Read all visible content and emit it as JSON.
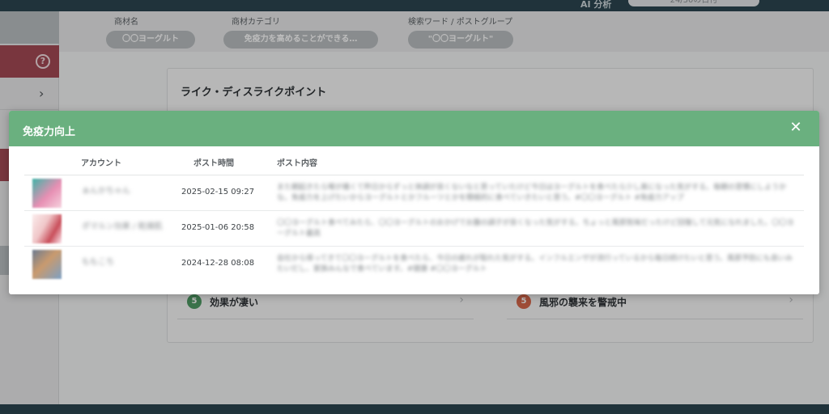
{
  "topbar": {
    "ai_label": "AI 分析",
    "pill_text": "24/30の日付"
  },
  "filters": [
    {
      "label": "商材名",
      "value": "〇〇ヨーグルト"
    },
    {
      "label": "商材カテゴリ",
      "value": "免疫力を高めることができる…"
    },
    {
      "label": "検索ワード / ポストグループ",
      "value": "\"〇〇ヨーグルト\""
    }
  ],
  "panel": {
    "title": "ライク・ディスライクポイント",
    "items": [
      {
        "num": "5",
        "text": "効果が凄い",
        "color": "#4f9a64"
      },
      {
        "num": "5",
        "text": "風邪の襲来を警戒中",
        "color": "#d6674b"
      }
    ]
  },
  "modal": {
    "title": "免疫力向上",
    "close_icon": "close-icon",
    "columns": {
      "account": "アカウント",
      "time": "ポスト時間",
      "content": "ポスト内容"
    },
    "rows": [
      {
        "account": "ぁんかちゃん",
        "time": "2025-02-15 09:27",
        "content": "また朝起きたら喉が痛くて昨日からずっと体調が良くないなと思っていたけど今日はヨーグルトを食べたら少し楽になった気がする。毎朝の習慣にしようかな。免疫力を上げたいからヨーグルトとかフルーツとかを積極的に食べていきたいと思う。#〇〇ヨーグルト #免疫力アップ",
        "avatar_colors": [
          "#3fb3a7",
          "#e78fb3"
        ]
      },
      {
        "account": "ポマルン効果 / 乾燥肌",
        "time": "2025-01-06 20:58",
        "content": "〇〇ヨーグルト食べてみたら、〇〇ヨーグルトのおかげでお腹の調子が良くなった気がする。ちょっと風邪気味だったけど回復して元気になれました。〇〇ヨーグルト最高",
        "avatar_colors": [
          "#f0c7c9",
          "#c94f5b"
        ]
      },
      {
        "account": "ももこち",
        "time": "2024-12-28 08:08",
        "content": "会社から帰ってきて〇〇ヨーグルトを食べたら、今日の疲れが取れた気がする。インフルエンザが流行っているから毎日続けたいと思う。風邪予防にも良いみたいだし、家族みんなで食べています。#健康 #〇〇ヨーグルト",
        "avatar_colors": [
          "#6b7a8f",
          "#c99a6e"
        ]
      }
    ]
  }
}
